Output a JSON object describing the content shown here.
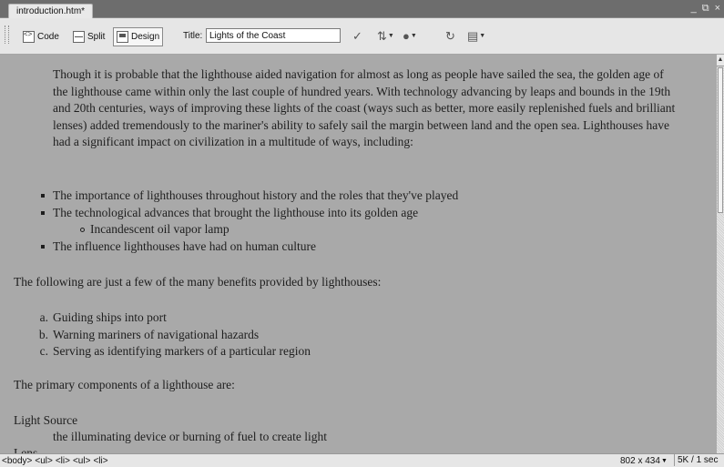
{
  "document": {
    "tab_label": "introduction.htm*"
  },
  "window_controls": {
    "minimize": "_",
    "restore": "⧉",
    "close": "×"
  },
  "toolbar": {
    "code_label": "Code",
    "split_label": "Split",
    "design_label": "Design",
    "title_label": "Title:",
    "title_value": "Lights of the Coast",
    "active_view": "Design"
  },
  "content": {
    "intro_paragraph": "Though it is probable that the lighthouse aided navigation for almost as long as people have sailed the sea, the golden age of the lighthouse came within only the last couple of hundred years. With technology advancing by leaps and bounds in the 19th and 20th centuries, ways of improving these lights of the coast (ways such as better, more easily replenished fuels and brilliant lenses) added tremendously to the mariner's ability to safely sail the margin between land and the open sea. Lighthouses have had a significant impact on civilization in a multitude of ways, including:",
    "bullets": [
      "The importance of lighthouses throughout history and the roles that they've played",
      "The technological advances that brought the lighthouse into its golden age",
      "The influence lighthouses have had on human culture"
    ],
    "sub_bullets": [
      "Incandescent oil vapor lamp"
    ],
    "benefits_lead": "The following are just a few of the many benefits provided by lighthouses:",
    "benefits": [
      {
        "marker": "a.",
        "text": "Guiding ships into port"
      },
      {
        "marker": "b.",
        "text": "Warning mariners of navigational hazards"
      },
      {
        "marker": "c.",
        "text": "Serving as identifying markers of a particular region"
      }
    ],
    "components_lead": "The primary components of a lighthouse are:",
    "definition_term": "Light Source",
    "definition_desc": "the illuminating device or burning of fuel to create light",
    "definition_term_next": "Lens"
  },
  "statusbar": {
    "tag_selector": [
      "<body>",
      "<ul>",
      "<li>",
      "<ul>",
      "<li>"
    ],
    "window_size": "802 x 434",
    "file_size": "5K / 1 sec"
  },
  "colors": {
    "content_background": "#a9a9a9",
    "toolbar_background": "#e6e6e6",
    "title_bar": "#6d6d6d"
  }
}
